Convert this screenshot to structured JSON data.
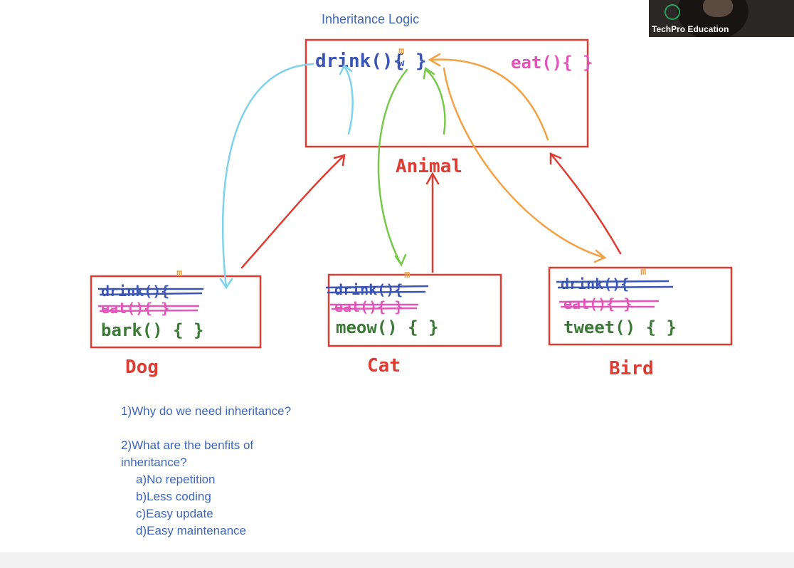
{
  "title": "Inheritance Logic",
  "parent": {
    "label": "Animal",
    "methods": {
      "drink": "drink(){",
      "drink_marks": [
        "m",
        "w"
      ],
      "drink_close": "}",
      "eat": "eat(){ }"
    }
  },
  "children": {
    "dog": {
      "label": "Dog",
      "inherited": [
        "drink(){",
        "eat(){ }"
      ],
      "own": "bark() { }",
      "mark": "m"
    },
    "cat": {
      "label": "Cat",
      "inherited": [
        "drink(){",
        "eat(){ }"
      ],
      "own": "meow() { }",
      "mark": "m"
    },
    "bird": {
      "label": "Bird",
      "inherited": [
        "drink(){",
        "eat(){ }"
      ],
      "own": "tweet() { }",
      "mark": "m"
    }
  },
  "notes": {
    "q1": "1)Why do we need inheritance?",
    "q2_line1": "2)What are the benfits of",
    "q2_line2": "inheritance?",
    "benefits": [
      "a)No repetition",
      "b)Less coding",
      "c)Easy update",
      "d)Easy maintenance"
    ]
  },
  "video": {
    "label": "TechPro Education"
  },
  "colors": {
    "red": "#de3b32",
    "blue": "#3a55b5",
    "pink": "#e255b8",
    "green": "#3a7a35",
    "cyan": "#7fd2ea",
    "lime": "#78c94a",
    "orange": "#f0a245",
    "title": "#3f67b8"
  }
}
